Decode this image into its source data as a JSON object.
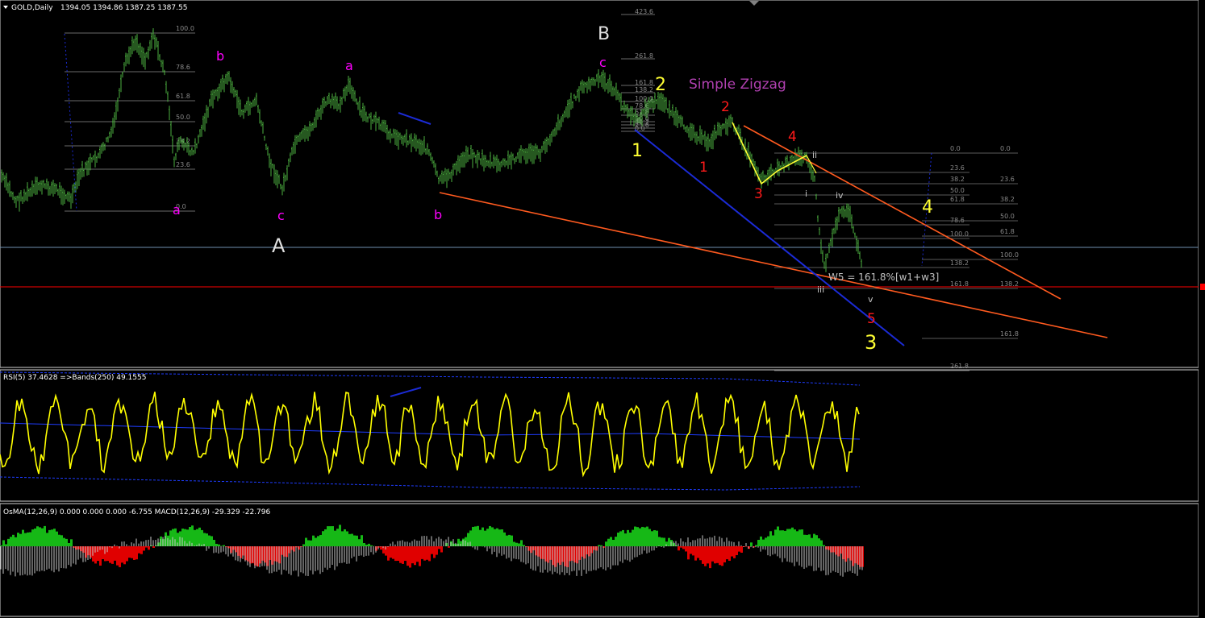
{
  "header": {
    "symbol": "GOLD,Daily",
    "ohlc": "1394.05 1394.86 1387.25 1387.55"
  },
  "rsi_header": "RSI(5) 37.4628  =>Bands(250) 49.1555",
  "macd_header": "OsMA(12,26,9) 0.000 0.000 0.000 -6.755  MACD(12,26,9) -29.329 -22.796",
  "annotations": {
    "title_zigzag": "Simple Zigzag",
    "w5_note": "W5 = 161.8%[w1+w3]",
    "A": "A",
    "B": "B",
    "magenta": {
      "a1": "a",
      "b1": "b",
      "c1": "c",
      "a2": "a",
      "b2": "b",
      "c2": "c"
    },
    "yellow": {
      "w1": "1",
      "w2": "2",
      "w3": "3",
      "w4": "4"
    },
    "red": {
      "w1": "1",
      "w2": "2",
      "w3": "3",
      "w4": "4",
      "w5": "5"
    },
    "roman": {
      "i": "i",
      "ii": "ii",
      "iii": "iii",
      "iv": "iv",
      "v": "v"
    }
  },
  "fib_left": [
    "100.0",
    "78.6",
    "61.8",
    "50.0",
    "38.2",
    "23.6",
    "0.0"
  ],
  "fib_top": [
    "423.6",
    "261.8",
    "161.8",
    "138.2",
    "100.0",
    "78.6",
    "61.8",
    "50.0",
    "38.2",
    "23.6",
    "0.0"
  ],
  "fib_right_a": [
    "0.0",
    "23.6",
    "38.2",
    "50.0",
    "61.8",
    "78.6",
    "100.0",
    "138.2",
    "161.8",
    "261.8"
  ],
  "fib_right_b": [
    "0.0",
    "23.6",
    "38.2",
    "50.0",
    "61.8",
    "100.0",
    "138.2",
    "161.8"
  ],
  "colors": {
    "price": "#4caf3f",
    "rsi": "#ffff00",
    "band": "#1e3cff",
    "osma_up": "#16b816",
    "osma_down": "#e00000",
    "trend_blue": "#1b2bd6",
    "trend_orange": "#ff5a1f",
    "support_red": "#ff0000",
    "support_gray": "#7090b0",
    "magenta": "#ff00ff",
    "yellow": "#ffff33",
    "red_label": "#ff1a1a"
  }
}
